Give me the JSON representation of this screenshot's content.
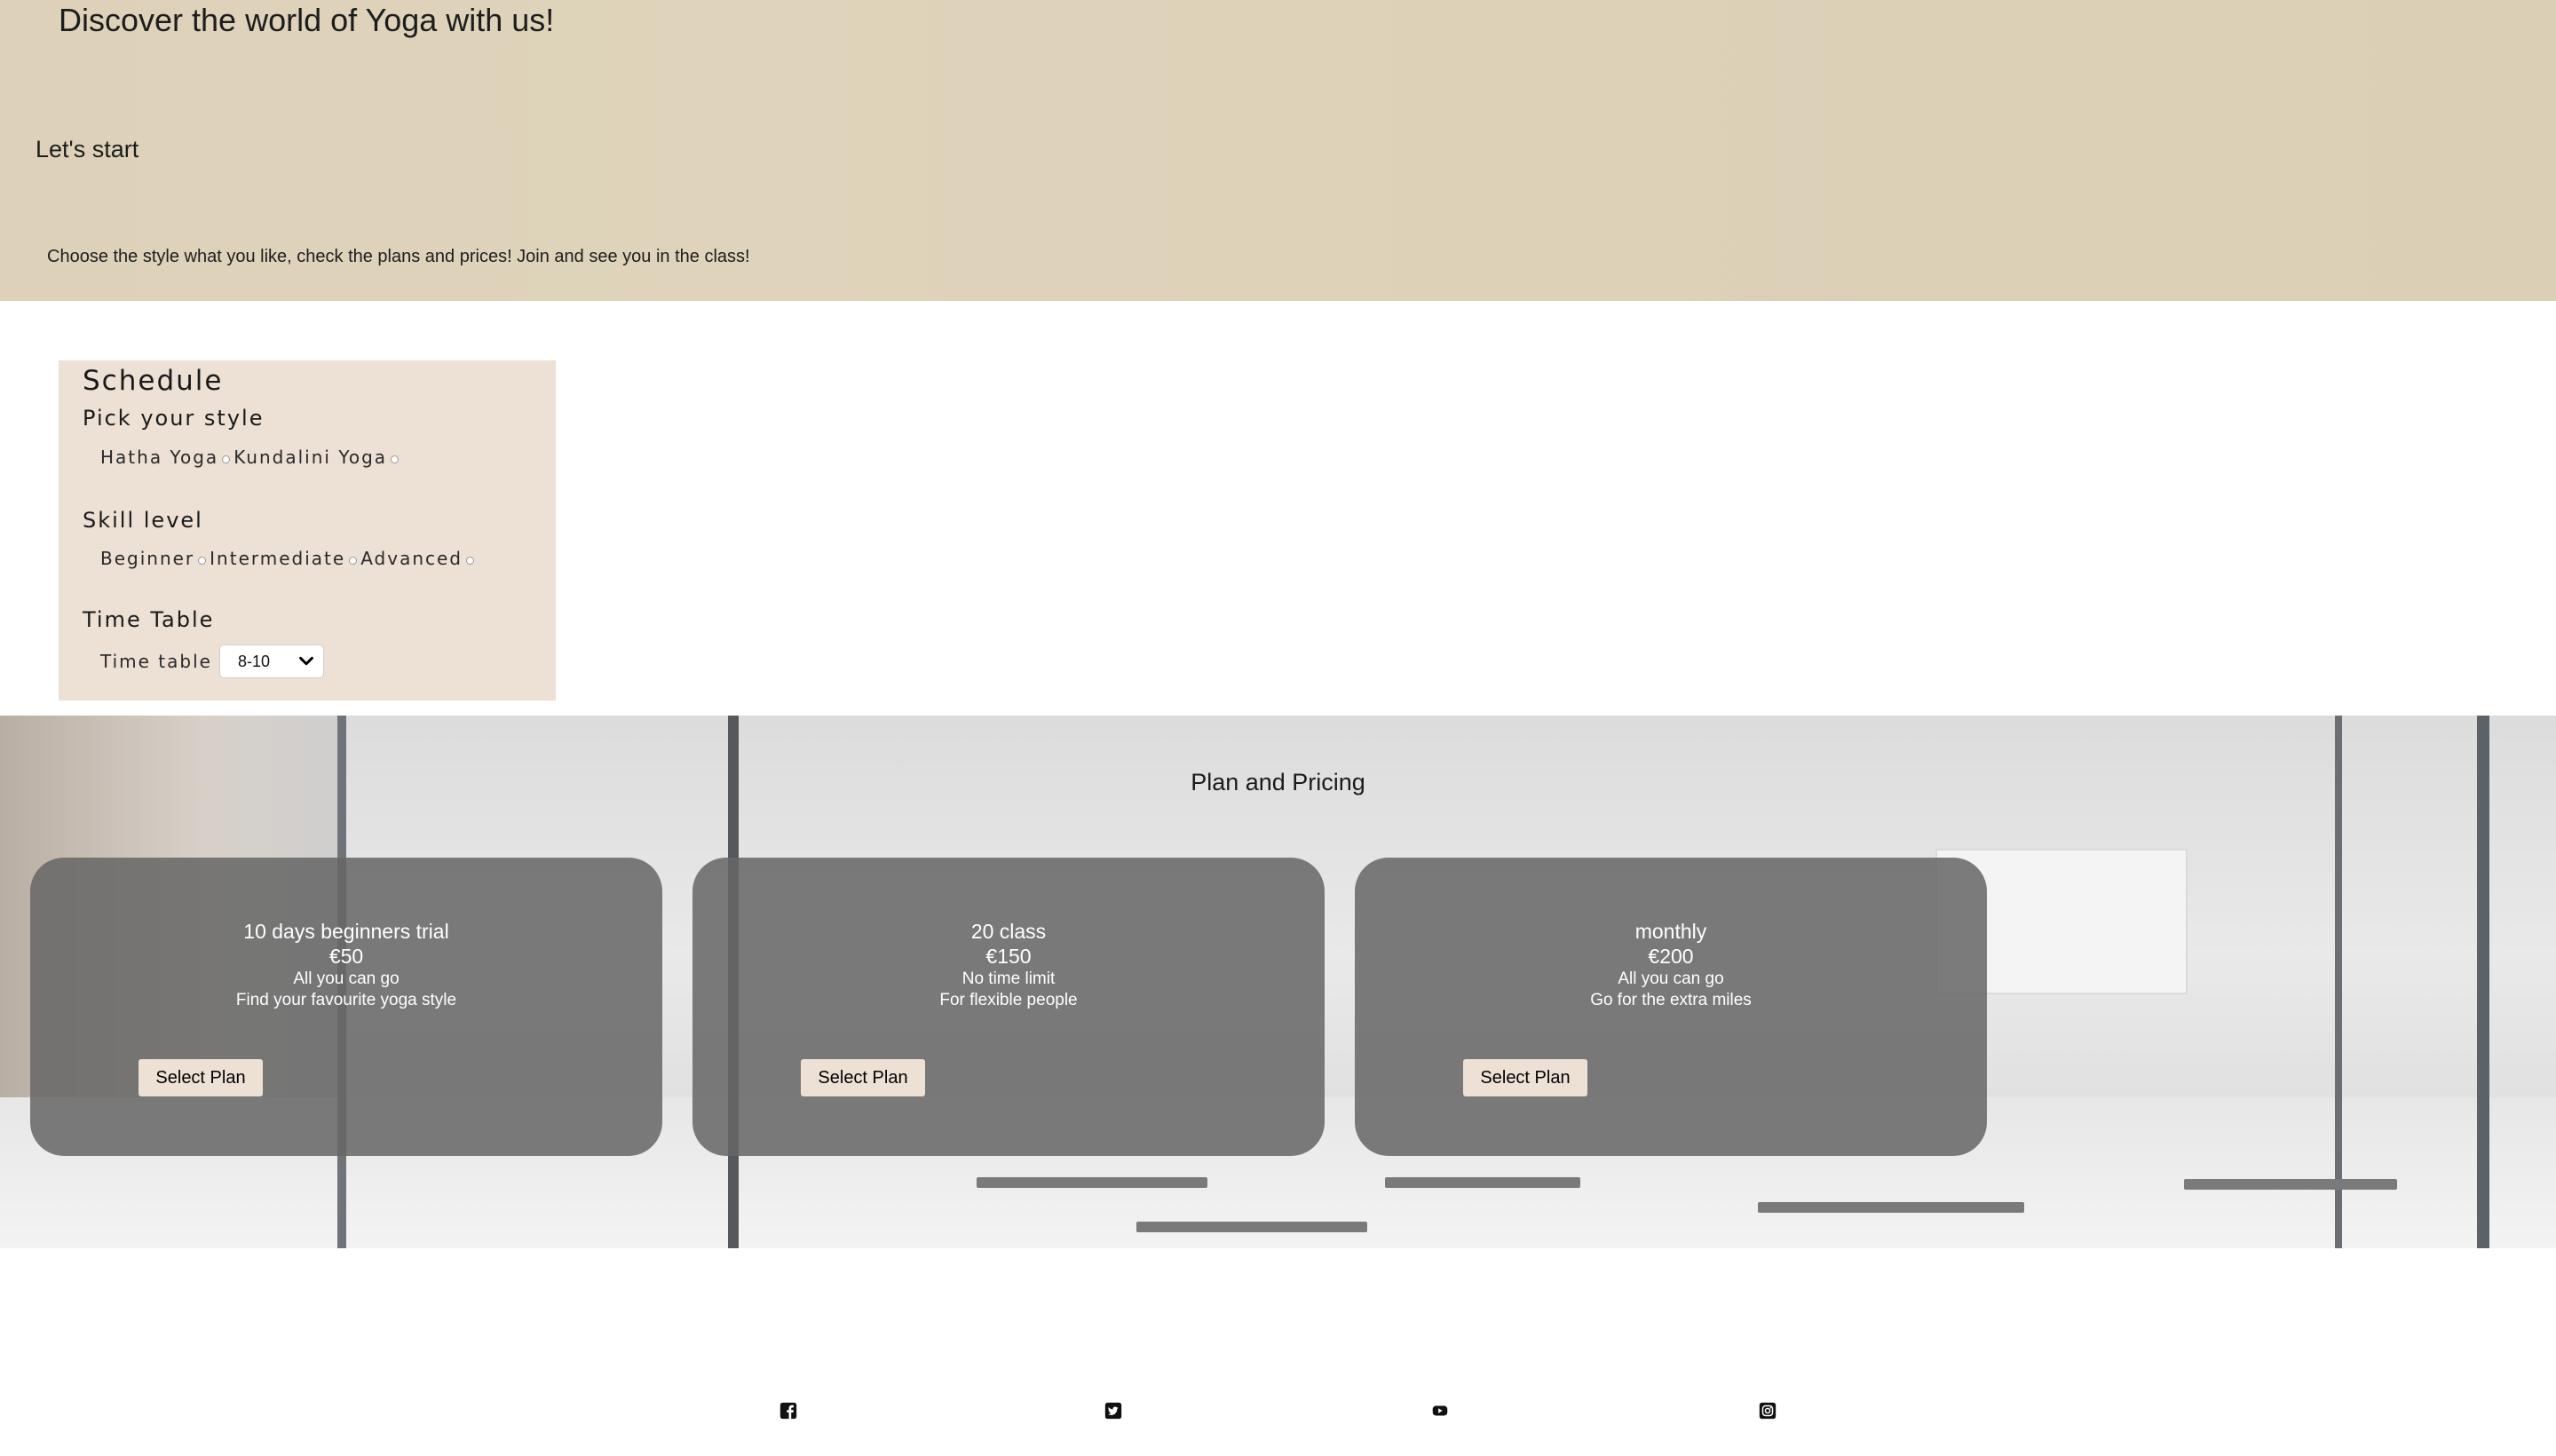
{
  "hero": {
    "title": "Discover the world of Yoga with us!",
    "subtitle": "Let's start",
    "description": "Choose the style what you like, check the plans and prices! Join and see you in the class!"
  },
  "schedule": {
    "title": "Schedule",
    "style": {
      "heading": "Pick your style",
      "options": [
        "Hatha Yoga",
        "Kundalini Yoga"
      ]
    },
    "skill": {
      "heading": "Skill level",
      "options": [
        "Beginner",
        "Intermediate",
        "Advanced"
      ]
    },
    "timetable": {
      "heading": "Time Table",
      "label": "Time table",
      "selected": "8-10"
    }
  },
  "pricing": {
    "title": "Plan and Pricing",
    "plans": [
      {
        "name": "10 days beginners trial",
        "price": "€50",
        "line1": "All you can go",
        "line2": "Find your favourite yoga style",
        "button": "Select Plan"
      },
      {
        "name": "20 class",
        "price": "€150",
        "line1": "No time limit",
        "line2": "For flexible people",
        "button": "Select Plan"
      },
      {
        "name": "monthly",
        "price": "€200",
        "line1": "All you can go",
        "line2": "Go for the extra miles",
        "button": "Select Plan"
      }
    ]
  },
  "footer": {
    "icons": [
      "facebook-icon",
      "twitter-icon",
      "youtube-icon",
      "instagram-icon"
    ]
  },
  "colors": {
    "hero_bg": "#ddd2b9",
    "schedule_bg": "#ede0d4",
    "card_bg": "#666666",
    "button_bg": "#ede0d4"
  }
}
